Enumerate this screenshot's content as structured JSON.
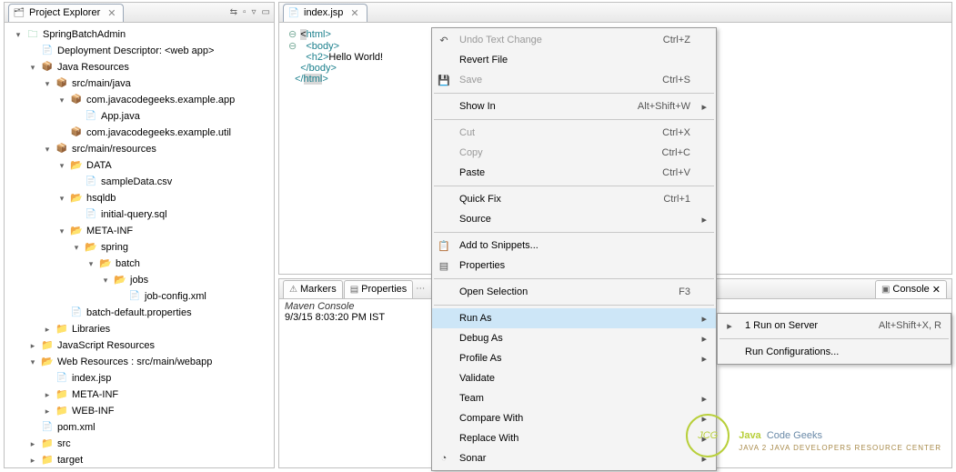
{
  "explorer": {
    "title": "Project Explorer",
    "tree": [
      {
        "d": 0,
        "tw": "▾",
        "ic": "proj",
        "label": "SpringBatchAdmin"
      },
      {
        "d": 1,
        "tw": "",
        "ic": "jfile",
        "label": "Deployment Descriptor: <web app>"
      },
      {
        "d": 1,
        "tw": "▾",
        "ic": "pkg",
        "label": "Java Resources"
      },
      {
        "d": 2,
        "tw": "▾",
        "ic": "pkg",
        "label": "src/main/java"
      },
      {
        "d": 3,
        "tw": "▾",
        "ic": "pkg",
        "label": "com.javacodegeeks.example.app"
      },
      {
        "d": 4,
        "tw": "",
        "ic": "jfile",
        "label": "App.java"
      },
      {
        "d": 3,
        "tw": "",
        "ic": "pkg",
        "label": "com.javacodegeeks.example.util"
      },
      {
        "d": 2,
        "tw": "▾",
        "ic": "pkg",
        "label": "src/main/resources"
      },
      {
        "d": 3,
        "tw": "▾",
        "ic": "folder-open",
        "label": "DATA"
      },
      {
        "d": 4,
        "tw": "",
        "ic": "jfile",
        "label": "sampleData.csv"
      },
      {
        "d": 3,
        "tw": "▾",
        "ic": "folder-open",
        "label": "hsqldb"
      },
      {
        "d": 4,
        "tw": "",
        "ic": "jfile",
        "label": "initial-query.sql"
      },
      {
        "d": 3,
        "tw": "▾",
        "ic": "folder-open",
        "label": "META-INF"
      },
      {
        "d": 4,
        "tw": "▾",
        "ic": "folder-open",
        "label": "spring"
      },
      {
        "d": 5,
        "tw": "▾",
        "ic": "folder-open",
        "label": "batch"
      },
      {
        "d": 6,
        "tw": "▾",
        "ic": "folder-open",
        "label": "jobs"
      },
      {
        "d": 7,
        "tw": "",
        "ic": "jfile",
        "label": "job-config.xml"
      },
      {
        "d": 3,
        "tw": "",
        "ic": "jfile",
        "label": "batch-default.properties"
      },
      {
        "d": 2,
        "tw": "▸",
        "ic": "folder-closed",
        "label": "Libraries"
      },
      {
        "d": 1,
        "tw": "▸",
        "ic": "folder-closed",
        "label": "JavaScript Resources"
      },
      {
        "d": 1,
        "tw": "▾",
        "ic": "folder-open",
        "label": "Web Resources : src/main/webapp"
      },
      {
        "d": 2,
        "tw": "",
        "ic": "jfile",
        "label": "index.jsp"
      },
      {
        "d": 2,
        "tw": "▸",
        "ic": "folder-closed",
        "label": "META-INF"
      },
      {
        "d": 2,
        "tw": "▸",
        "ic": "folder-closed",
        "label": "WEB-INF"
      },
      {
        "d": 1,
        "tw": "",
        "ic": "jfile",
        "label": "pom.xml"
      },
      {
        "d": 1,
        "tw": "▸",
        "ic": "folder-closed",
        "label": "src"
      },
      {
        "d": 1,
        "tw": "▸",
        "ic": "folder-closed",
        "label": "target"
      }
    ]
  },
  "editor": {
    "tab": "index.jsp",
    "lines": [
      {
        "m": "⊖",
        "html": "<span class='hl'>&lt;</span><span class='tag'>html</span><span class='tag'>&gt;</span>"
      },
      {
        "m": "⊖",
        "html": "  <span class='tag'>&lt;body&gt;</span>"
      },
      {
        "m": "",
        "html": "    <span class='tag'>&lt;h2&gt;</span><span class='txt'>Hello World!</span>"
      },
      {
        "m": "",
        "html": "  <span class='tag'>&lt;/body&gt;</span>"
      },
      {
        "m": "",
        "html": "<span class='tag'>&lt;/</span><span class='tag hl'>html</span><span class='tag'>&gt;</span>"
      }
    ]
  },
  "bottom": {
    "tabs": [
      "Markers",
      "Properties"
    ],
    "rightTab": "Console",
    "consoleTitle": "Maven Console",
    "consoleLine": "9/3/15 8:03:20 PM IST"
  },
  "ctxmenu": {
    "items": [
      {
        "ic": "↶",
        "label": "Undo Text Change",
        "accel": "Ctrl+Z",
        "dis": true
      },
      {
        "ic": "",
        "label": "Revert File",
        "accel": "",
        "dis": false
      },
      {
        "ic": "💾",
        "label": "Save",
        "accel": "Ctrl+S",
        "dis": true
      },
      {
        "sep": true
      },
      {
        "ic": "",
        "label": "Show In",
        "accel": "Alt+Shift+W",
        "sub": true
      },
      {
        "sep": true
      },
      {
        "ic": "",
        "label": "Cut",
        "accel": "Ctrl+X",
        "dis": true
      },
      {
        "ic": "",
        "label": "Copy",
        "accel": "Ctrl+C",
        "dis": true
      },
      {
        "ic": "",
        "label": "Paste",
        "accel": "Ctrl+V"
      },
      {
        "sep": true
      },
      {
        "ic": "",
        "label": "Quick Fix",
        "accel": "Ctrl+1"
      },
      {
        "ic": "",
        "label": "Source",
        "sub": true
      },
      {
        "sep": true
      },
      {
        "ic": "📋",
        "label": "Add to Snippets..."
      },
      {
        "ic": "▤",
        "label": "Properties"
      },
      {
        "sep": true
      },
      {
        "ic": "",
        "label": "Open Selection",
        "accel": "F3"
      },
      {
        "sep": true
      },
      {
        "ic": "",
        "label": "Run As",
        "sub": true,
        "hi": true
      },
      {
        "ic": "",
        "label": "Debug As",
        "sub": true
      },
      {
        "ic": "",
        "label": "Profile As",
        "sub": true
      },
      {
        "ic": "",
        "label": "Validate"
      },
      {
        "ic": "",
        "label": "Team",
        "sub": true
      },
      {
        "ic": "",
        "label": "Compare With",
        "sub": true
      },
      {
        "ic": "",
        "label": "Replace With",
        "sub": true
      },
      {
        "ic": "◔",
        "label": "Sonar",
        "sub": true
      }
    ]
  },
  "submenu": {
    "items": [
      {
        "ic": "▸",
        "label": "1 Run on Server",
        "accel": "Alt+Shift+X, R"
      },
      {
        "sep": true
      },
      {
        "ic": "",
        "label": "Run Configurations..."
      }
    ]
  },
  "logo": {
    "brand": "JCG",
    "l1a": "Java",
    "l1b": "Code Geeks",
    "l2": "Java 2 Java Developers Resource Center"
  }
}
